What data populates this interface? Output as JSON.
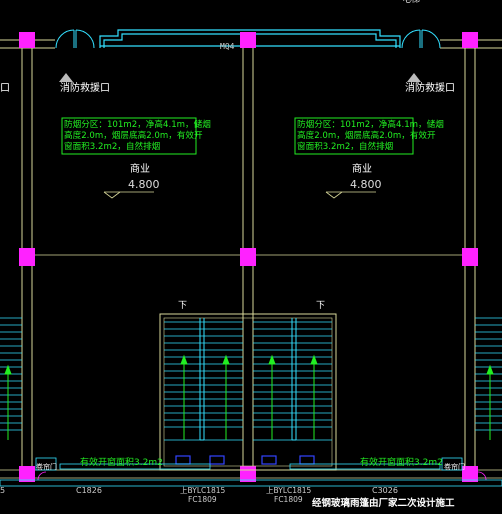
{
  "colors": {
    "background": "#000000",
    "wall": "#d8d89a",
    "cyan": "#33e0ff",
    "magenta": "#ff22ff",
    "green": "#22ee22",
    "white": "#ffffff",
    "blue": "#3344ff"
  },
  "labels": {
    "top_edge": "电梯",
    "mq_tag": "MQ4",
    "rescue_left": "消防救援口",
    "rescue_mid": "消防救援口",
    "rescue_right": "消防救援口",
    "fire_note_left": "防烟分区：101m2，净高4.1m，储烟\n高度2.0m，烟层底高2.0m，有效开\n窗面积3.2m2，自然排烟",
    "fire_note_right": "防烟分区：101m2，净高4.1m，储烟\n高度2.0m，烟层底高2.0m，有效开\n窗面积3.2m2，自然排烟",
    "commerce_left": "商业",
    "elev_left": "4.800",
    "commerce_right": "商业",
    "elev_right": "4.800",
    "stair_down_left": "下",
    "stair_down_right": "下",
    "vent_area_left": "有效开窗面积3.2m2",
    "vent_area_right": "有效开窗面积3.2m2",
    "corner_tag_left": "卷帘门",
    "corner_tag_right": "卷帘门",
    "window_c1826": "C1826",
    "window_c3026": "C3026",
    "shaft_tag_left": "上BYLC1815",
    "shaft_tag_right": "上BYLC1815",
    "fc_tag_left": "FC1809",
    "fc_tag_right": "FC1809",
    "bottom_note": "经钢玻璃雨篷由厂家二次设计施工",
    "left_edge_1": "口",
    "left_edge_2": "5"
  }
}
